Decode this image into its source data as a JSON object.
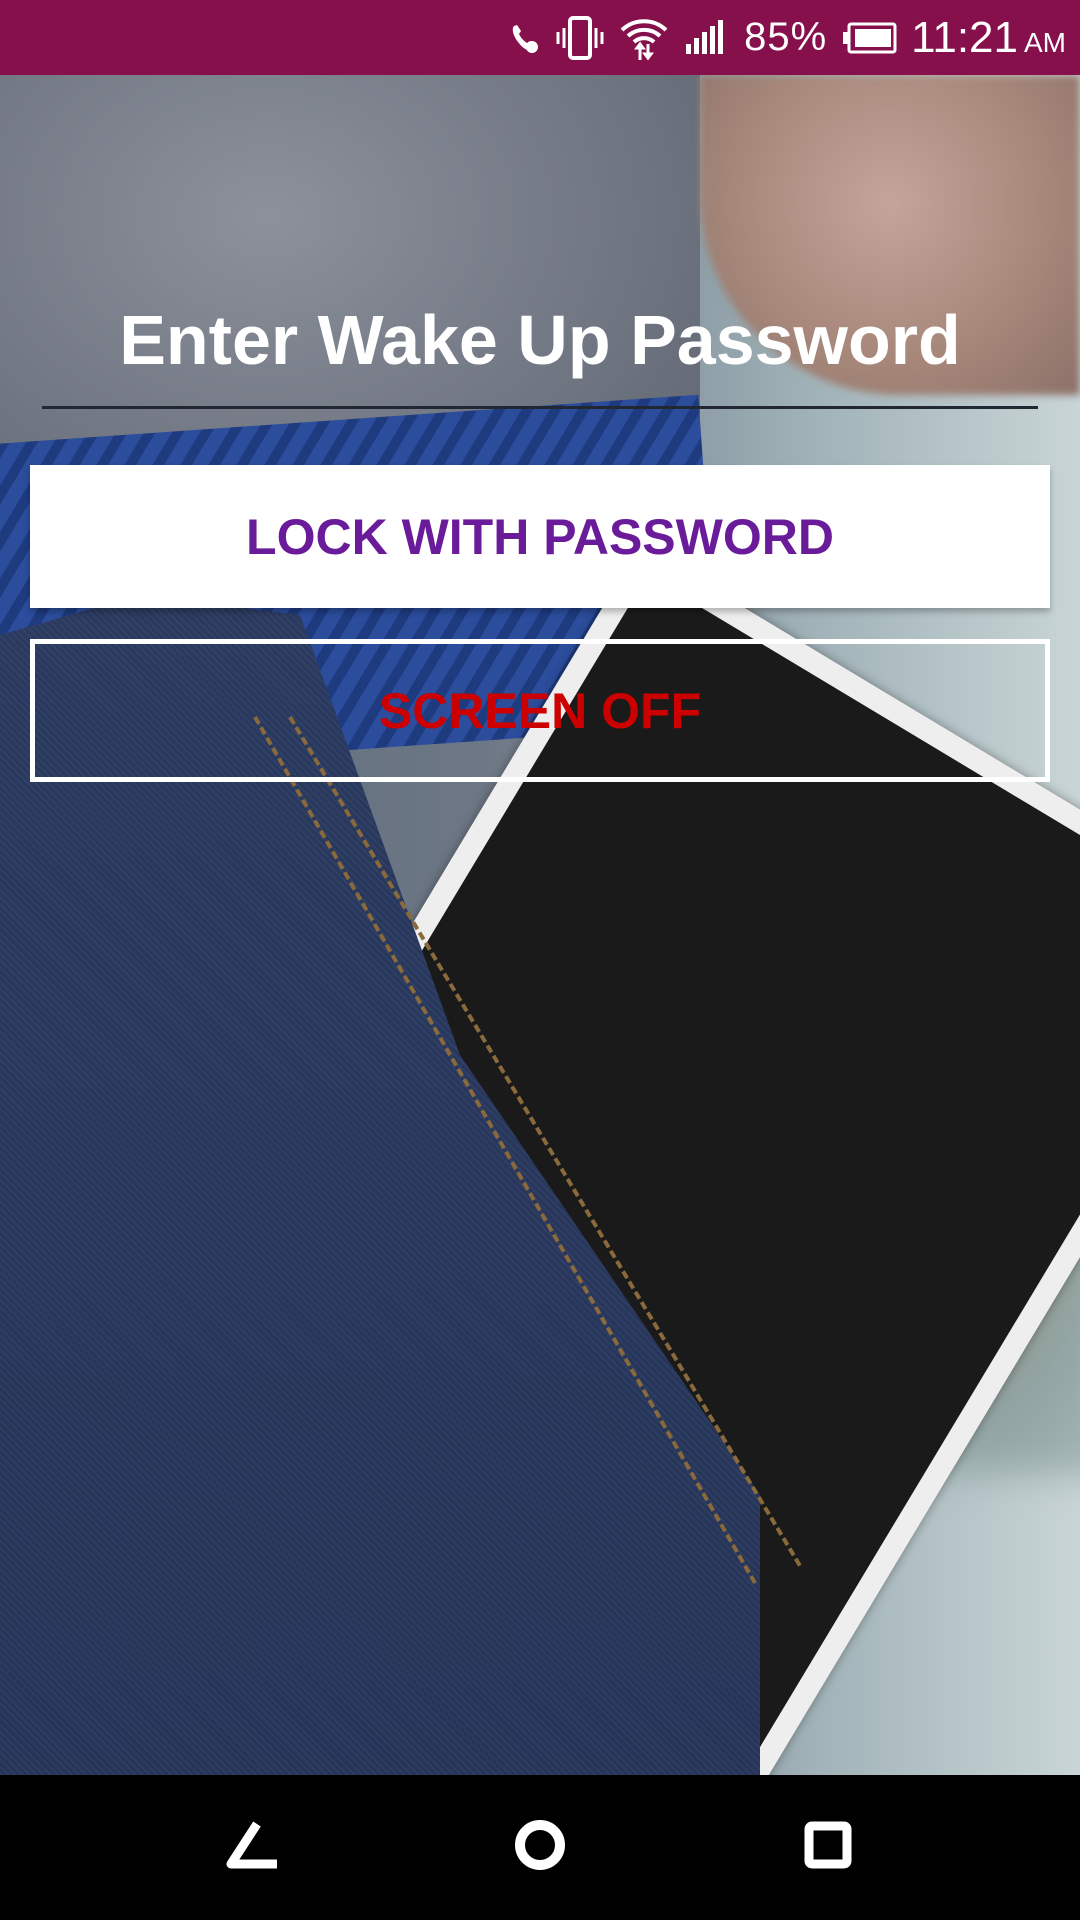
{
  "status_bar": {
    "battery_percent": "85%",
    "time": "11:21",
    "ampm": "AM",
    "background_color": "#86104b",
    "icons": [
      "call-icon",
      "vibrate-icon",
      "wifi-icon",
      "signal-icon",
      "battery-icon"
    ]
  },
  "main": {
    "title": "Enter Wake Up Password",
    "lock_button_label": "LOCK WITH PASSWORD",
    "screen_off_button_label": "SCREEN OFF",
    "lock_button_text_color": "#6a1b9a",
    "screen_off_text_color": "#cc0000"
  },
  "nav_bar": {
    "icons": [
      "back-icon",
      "home-icon",
      "recents-icon"
    ]
  }
}
